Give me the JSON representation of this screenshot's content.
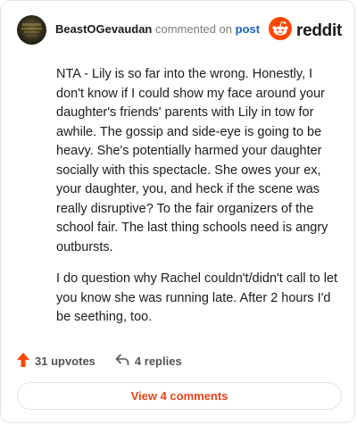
{
  "comment": {
    "username": "BeastOGevaudan",
    "action_text": "commented on",
    "post_link": "post",
    "paragraphs": [
      "NTA - Lily is so far into the wrong. Honestly, I don't know if I could show my face around your daughter's friends' parents with Lily in tow for awhile. The gossip and side-eye is going to be heavy. She's potentially harmed your daughter socially with this spectacle. She owes your ex, your daughter, you, and heck if the scene was really disruptive? To the fair organizers of the school fair. The last thing schools need is angry outbursts.",
      "I do question why Rachel couldn't/didn't call to let you know she was running late. After 2 hours I'd be seething, too."
    ]
  },
  "brand": {
    "name": "reddit",
    "color": "#ff4500"
  },
  "actions": {
    "upvotes": "31 upvotes",
    "replies": "4 replies"
  },
  "view_button": {
    "label": "View 4 comments",
    "color": "#e8431a"
  },
  "icons": {
    "upvote": "upvote-arrow-icon",
    "reply": "reply-arrow-icon",
    "brand": "reddit-snoo-icon"
  }
}
